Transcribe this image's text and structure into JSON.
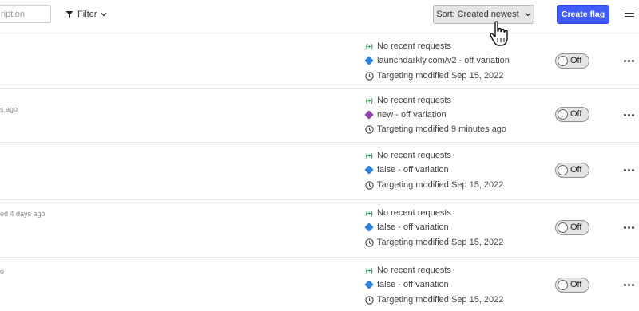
{
  "toolbar": {
    "search_placeholder": "ription",
    "filter_label": "Filter",
    "sort_label": "Sort: Created newest",
    "create_label": "Create flag"
  },
  "rows": [
    {
      "meta": "",
      "requests": "No recent requests",
      "variation": "launchdarkly.com/v2 - off variation",
      "variation_color": "#2f7fdc",
      "modified": "Targeting modified Sep 15, 2022",
      "toggle_label": "Off"
    },
    {
      "meta": "s ago",
      "requests": "No recent requests",
      "variation": "new - off variation",
      "variation_color": "#8e44ad",
      "modified": "Targeting modified 9 minutes ago",
      "toggle_label": "Off"
    },
    {
      "meta": "",
      "requests": "No recent requests",
      "variation": "false - off variation",
      "variation_color": "#2f7fdc",
      "modified": "Targeting modified Sep 15, 2022",
      "toggle_label": "Off"
    },
    {
      "meta": "ed 4 days ago",
      "requests": "No recent requests",
      "variation": "false - off variation",
      "variation_color": "#2f7fdc",
      "modified": "Targeting modified Sep 15, 2022",
      "toggle_label": "Off"
    },
    {
      "meta": "o",
      "requests": "No recent requests",
      "variation": "false - off variation",
      "variation_color": "#2f7fdc",
      "modified": "Targeting modified Sep 15, 2022",
      "toggle_label": "Off"
    }
  ],
  "colors": {
    "primary": "#405bff",
    "requests_icon": "#2d9e55"
  }
}
